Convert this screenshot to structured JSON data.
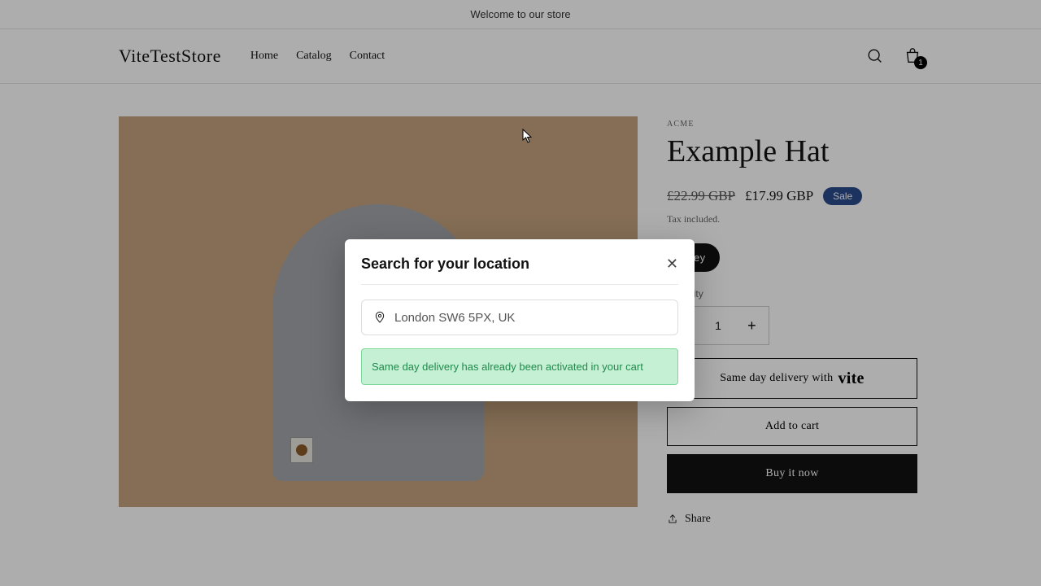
{
  "announcement": "Welcome to our store",
  "logo": "ViteTestStore",
  "nav": {
    "home": "Home",
    "catalog": "Catalog",
    "contact": "Contact"
  },
  "cart_count": "1",
  "product": {
    "vendor": "ACME",
    "title": "Example Hat",
    "price_old": "£22.99 GBP",
    "price_new": "£17.99 GBP",
    "sale_label": "Sale",
    "tax": "Tax included.",
    "variant": "Grey",
    "qty_label": "Quantity",
    "qty_value": "1",
    "sameday_prefix": "Same day delivery with",
    "sameday_brand": "vite",
    "add_to_cart": "Add to cart",
    "buy_now": "Buy it now",
    "share": "Share"
  },
  "modal": {
    "title": "Search for your location",
    "input_value": "London SW6 5PX, UK",
    "alert": "Same day delivery has already been activated in your cart"
  }
}
